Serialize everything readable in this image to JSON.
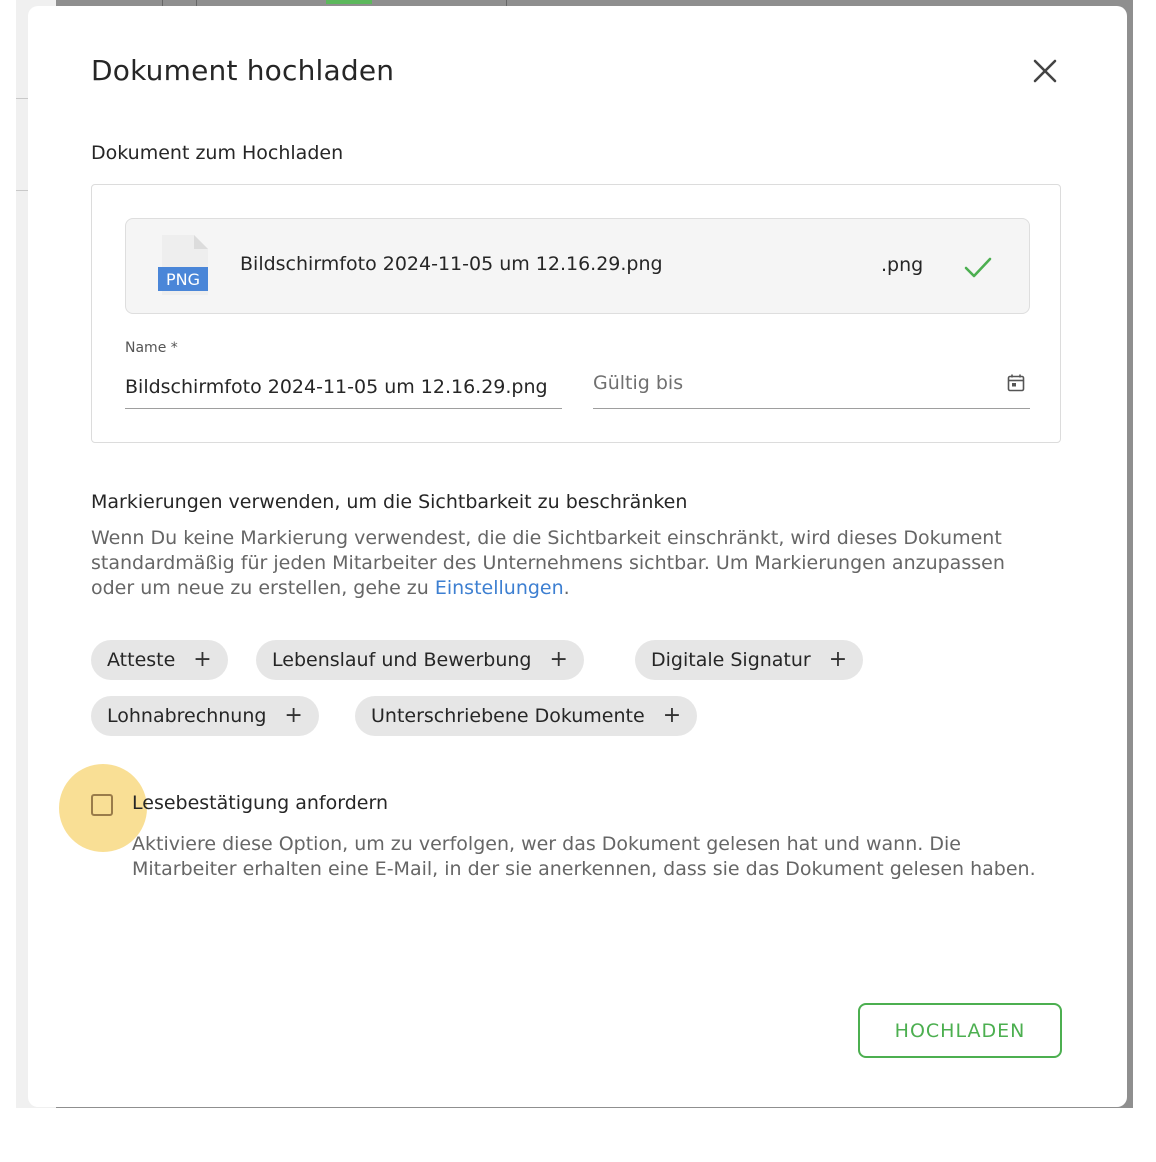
{
  "modal": {
    "title": "Dokument hochladen",
    "close_icon": "close-icon"
  },
  "upload": {
    "section_label": "Dokument zum Hochladen",
    "file": {
      "icon": "png-file-icon",
      "icon_label": "PNG",
      "name": "Bildschirmfoto 2024-11-05 um 12.16.29.png",
      "extension": ".png",
      "status_icon": "check-icon"
    },
    "name_field": {
      "label": "Name *",
      "value": "Bildschirmfoto 2024-11-05 um 12.16.29.png"
    },
    "valid_until": {
      "placeholder": "Gültig bis",
      "icon": "calendar-icon"
    }
  },
  "tags": {
    "heading": "Markierungen verwenden, um die Sichtbarkeit zu beschränken",
    "description": "Wenn Du keine Markierung verwendest, die die Sichtbarkeit einschränkt, wird dieses Dokument standardmäßig für jeden Mitarbeiter des Unternehmens sichtbar. Um Markierungen anzupassen oder um neue zu erstellen, gehe zu ",
    "settings_link": "Einstellungen",
    "description_end": ".",
    "chip_plus": "+",
    "items": [
      {
        "label": "Atteste"
      },
      {
        "label": "Lebenslauf und Bewerbung"
      },
      {
        "label": "Digitale Signatur"
      },
      {
        "label": "Lohnabrechnung"
      },
      {
        "label": "Unterschriebene Dokumente"
      }
    ]
  },
  "read_receipt": {
    "label": "Lesebestätigung anfordern",
    "checked": false,
    "description": "Aktiviere diese Option, um zu verfolgen, wer das Dokument gelesen hat und wann. Die Mitarbeiter erhalten eine E-Mail, in der sie anerkennen, dass sie das Dokument gelesen haben."
  },
  "actions": {
    "upload_label": "HOCHLADEN"
  },
  "colors": {
    "accent_green": "#4caf50",
    "link_blue": "#3d7fd1",
    "highlight_yellow": "#f8d77a"
  }
}
